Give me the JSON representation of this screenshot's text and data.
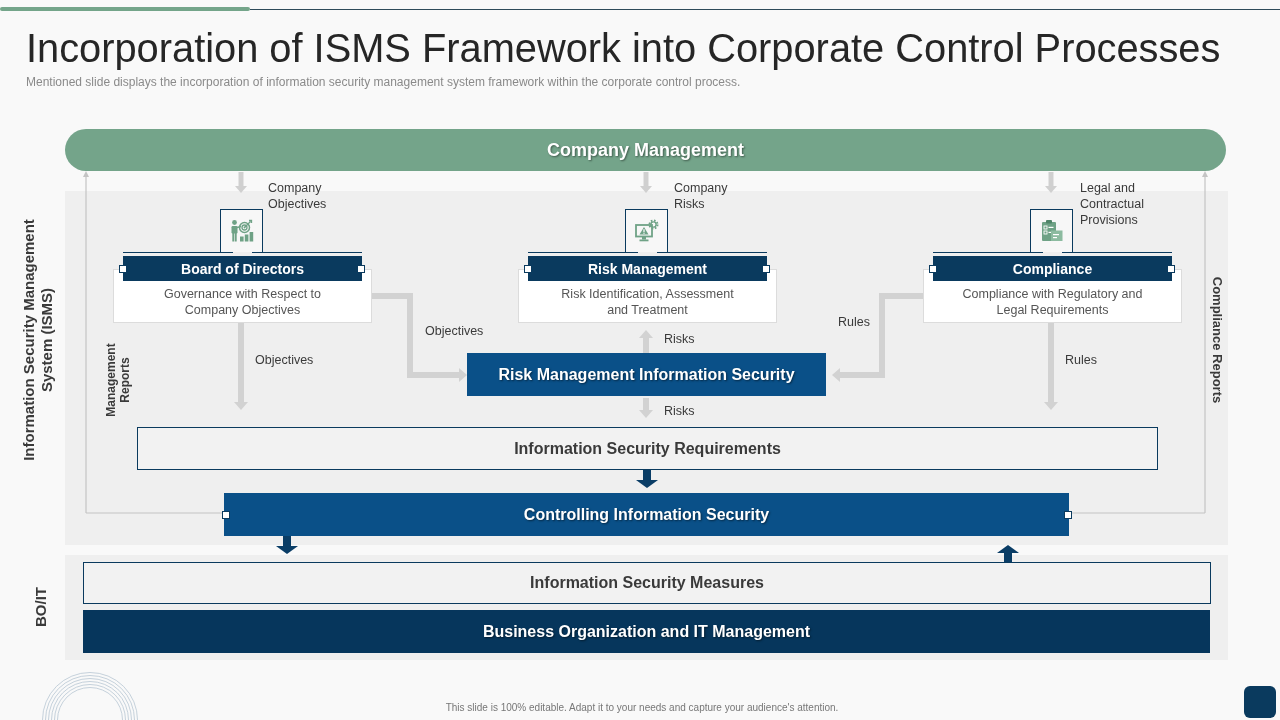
{
  "header": {
    "title": "Incorporation of ISMS Framework into Corporate Control Processes",
    "subtitle": "Mentioned slide displays the incorporation of information security management system framework within the corporate control process."
  },
  "top_bar": {
    "label": "Company Management"
  },
  "isms_panel": {
    "label": "Information Security Management System (ISMS)",
    "left_line_label": "Management Reports",
    "right_line_label": "Compliance Reports"
  },
  "columns": [
    {
      "input": "Company Objectives",
      "title": "Board of Directors",
      "description": "Governance with Respect to Company Objectives",
      "flows": [
        {
          "kind": "side",
          "label": "Objectives"
        },
        {
          "kind": "down",
          "label": "Objectives"
        }
      ]
    },
    {
      "input": "Company Risks",
      "title": "Risk Management",
      "description": "Risk Identification, Assessment and Treatment",
      "flows": [
        {
          "kind": "up",
          "label": "Risks"
        },
        {
          "kind": "down",
          "label": "Risks"
        }
      ]
    },
    {
      "input": "Legal and Contractual Provisions",
      "title": "Compliance",
      "description": "Compliance with Regulatory and Legal Requirements",
      "flows": [
        {
          "kind": "side",
          "label": "Rules"
        },
        {
          "kind": "down",
          "label": "Rules"
        }
      ]
    }
  ],
  "center_node": {
    "label": "Risk Management Information Security"
  },
  "requirements_bar": {
    "label": "Information Security Requirements"
  },
  "controlling_bar": {
    "label": "Controlling Information Security"
  },
  "bo_it_panel": {
    "label": "BO/IT",
    "measures_bar": "Information Security Measures",
    "management_bar": "Business Organization and IT Management"
  },
  "footer": {
    "note": "This slide is 100% editable. Adapt it to your needs and capture your audience's attention."
  }
}
